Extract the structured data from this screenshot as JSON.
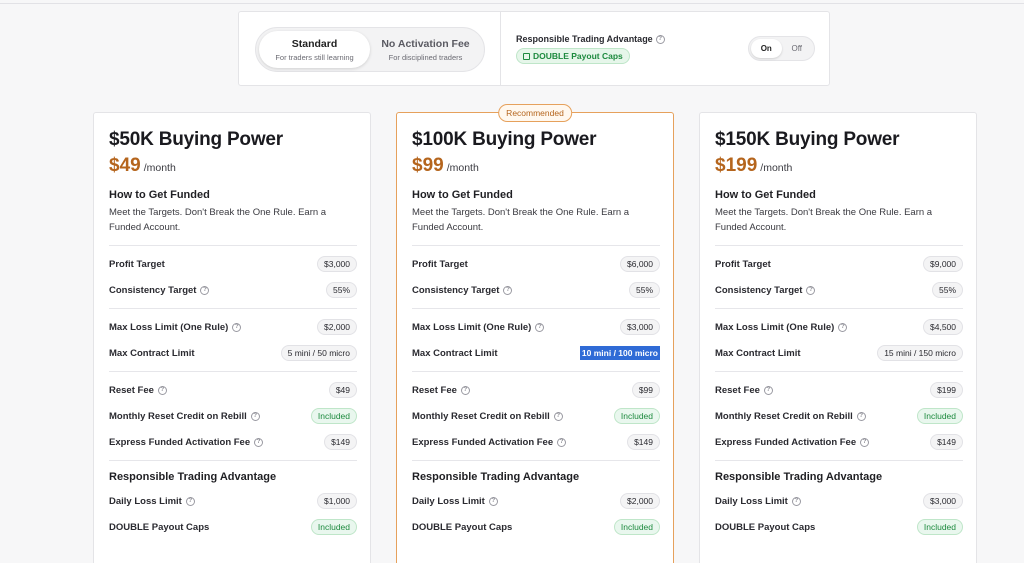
{
  "plan_toggle": {
    "standard": {
      "title": "Standard",
      "subtitle": "For traders still learning"
    },
    "no_fee": {
      "title": "No Activation Fee",
      "subtitle": "For disciplined traders"
    }
  },
  "rta": {
    "title": "Responsible Trading Advantage",
    "badge": "DOUBLE Payout Caps",
    "on_label": "On",
    "off_label": "Off"
  },
  "labels": {
    "how_title": "How to Get Funded",
    "how_desc": "Meet the Targets. Don't Break the One Rule. Earn a Funded Account.",
    "per_month": "/month",
    "profit_target": "Profit Target",
    "consistency_target": "Consistency Target",
    "max_loss": "Max Loss Limit (One Rule)",
    "max_contract": "Max Contract Limit",
    "reset_fee": "Reset Fee",
    "monthly_reset": "Monthly Reset Credit on Rebill",
    "express_fee": "Express Funded Activation Fee",
    "rta_section": "Responsible Trading Advantage",
    "daily_loss": "Daily Loss Limit",
    "double_caps": "DOUBLE Payout Caps",
    "recommended": "Recommended"
  },
  "cards": [
    {
      "title": "$50K Buying Power",
      "price": "$49",
      "profit_target": "$3,000",
      "consistency": "55%",
      "max_loss": "$2,000",
      "max_contract": "5 mini / 50 micro",
      "reset_fee": "$49",
      "monthly_reset": "Included",
      "express_fee": "$149",
      "daily_loss": "$1,000",
      "double_caps": "Included"
    },
    {
      "title": "$100K Buying Power",
      "price": "$99",
      "profit_target": "$6,000",
      "consistency": "55%",
      "max_loss": "$3,000",
      "max_contract": "10 mini / 100 micro",
      "reset_fee": "$99",
      "monthly_reset": "Included",
      "express_fee": "$149",
      "daily_loss": "$2,000",
      "double_caps": "Included"
    },
    {
      "title": "$150K Buying Power",
      "price": "$199",
      "profit_target": "$9,000",
      "consistency": "55%",
      "max_loss": "$4,500",
      "max_contract": "15 mini / 150 micro",
      "reset_fee": "$199",
      "monthly_reset": "Included",
      "express_fee": "$149",
      "daily_loss": "$3,000",
      "double_caps": "Included"
    }
  ]
}
